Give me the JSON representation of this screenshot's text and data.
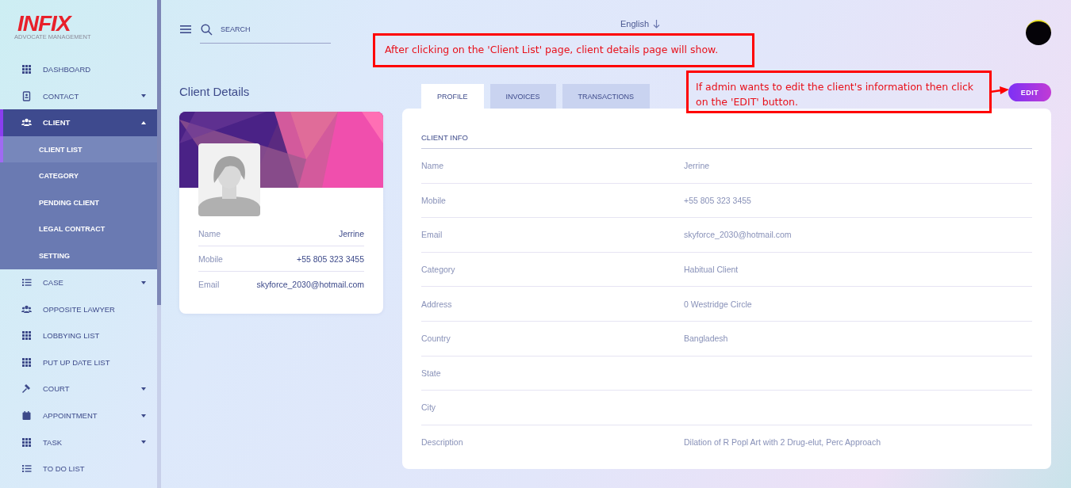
{
  "brand": {
    "logo": "INFIX",
    "tagline": "ADVOCATE MANAGEMENT"
  },
  "sidebar": {
    "items": [
      {
        "label": "DASHBOARD",
        "selected": false
      },
      {
        "label": "CONTACT",
        "selected": false,
        "expanded": false
      },
      {
        "label": "CLIENT",
        "selected": true,
        "expanded": true,
        "children": [
          {
            "label": "CLIENT LIST",
            "selected": true
          },
          {
            "label": "CATEGORY",
            "selected": false
          },
          {
            "label": "PENDING CLIENT",
            "selected": false
          },
          {
            "label": "LEGAL CONTRACT",
            "selected": false
          },
          {
            "label": "SETTING",
            "selected": false
          }
        ]
      },
      {
        "label": "CASE",
        "selected": false,
        "expanded": false
      },
      {
        "label": "OPPOSITE LAWYER",
        "selected": false
      },
      {
        "label": "LOBBYING LIST",
        "selected": false
      },
      {
        "label": "PUT UP DATE LIST",
        "selected": false
      },
      {
        "label": "COURT",
        "selected": false,
        "expanded": false
      },
      {
        "label": "APPOINTMENT",
        "selected": false,
        "expanded": false
      },
      {
        "label": "TASK",
        "selected": false,
        "expanded": false
      },
      {
        "label": "TO DO LIST",
        "selected": false
      }
    ]
  },
  "header": {
    "search": {
      "placeholder": "SEARCH"
    },
    "language": "English"
  },
  "page_title": "Client Details",
  "profile": {
    "fields": [
      {
        "label": "Name",
        "value": "Jerrine"
      },
      {
        "label": "Mobile",
        "value": "+55 805 323 3455"
      },
      {
        "label": "Email",
        "value": "skyforce_2030@hotmail.com"
      }
    ]
  },
  "tabs": [
    {
      "label": "PROFILE",
      "selected": true
    },
    {
      "label": "INVOICES",
      "selected": false
    },
    {
      "label": "TRANSACTIONS",
      "selected": false
    }
  ],
  "edit_button": "EDIT",
  "client_info": {
    "title": "CLIENT INFO",
    "rows": [
      {
        "label": "Name",
        "value": "Jerrine"
      },
      {
        "label": "Mobile",
        "value": "+55 805 323 3455"
      },
      {
        "label": "Email",
        "value": "skyforce_2030@hotmail.com"
      },
      {
        "label": "Category",
        "value": "Habitual Client"
      },
      {
        "label": "Address",
        "value": "0 Westridge Circle"
      },
      {
        "label": "Country",
        "value": "Bangladesh"
      },
      {
        "label": "State"
      },
      {
        "label": "City"
      },
      {
        "label": "Description",
        "value": "Dilation of R Popl Art with 2 Drug-elut, Perc Approach"
      }
    ]
  },
  "annotations": [
    {
      "text": "After clicking on the 'Client List' page, client details page will show."
    },
    {
      "text": "If admin wants to edit the client's information then click on the 'EDIT' button."
    }
  ]
}
